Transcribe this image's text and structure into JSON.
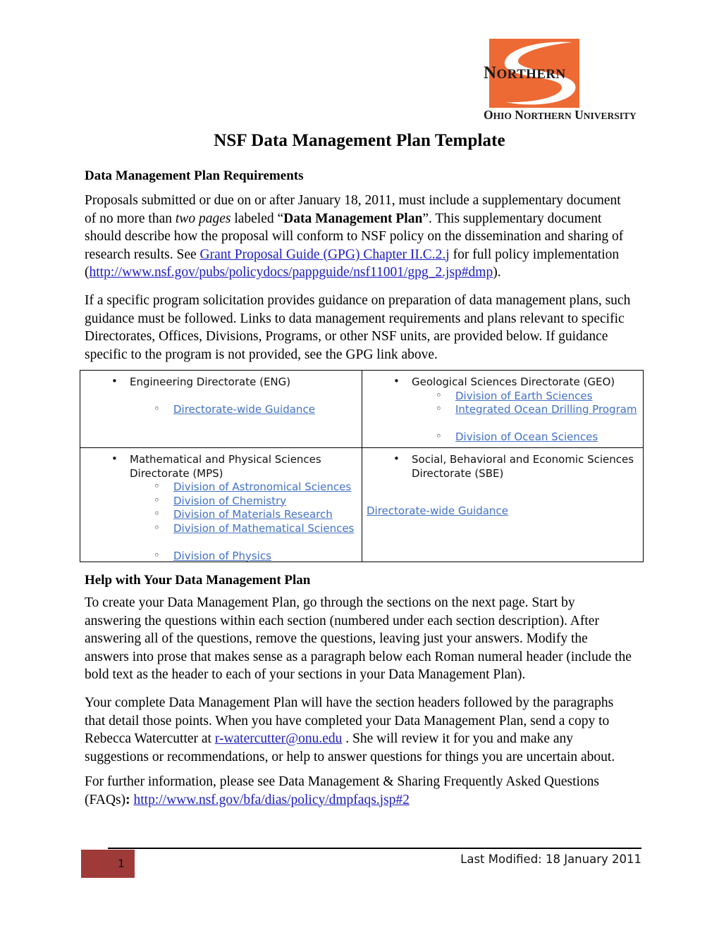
{
  "logo": {
    "word_main": "NORTHERN",
    "word_sub": "OHIO NORTHERN UNIVERSITY",
    "brand_color": "#ED6A35"
  },
  "document": {
    "title": "NSF Data Management Plan Template"
  },
  "sections": {
    "requirements_heading": "Data Management Plan Requirements",
    "para1": {
      "t1": "Proposals submitted or due on or after January 18, 2011, must include a supplementary document of no more than ",
      "italic1": "two pages",
      "t2": " labeled “",
      "bold1": "Data Management Plan",
      "t3": "”. This supplementary document should describe how the proposal will conform to NSF policy on the dissemination and sharing of research results. See ",
      "link1": "Grant Proposal Guide (GPG) Chapter II.C.2.j",
      "t4": " for full policy implementation (",
      "link2": "http://www.nsf.gov/pubs/policydocs/pappguide/nsf11001/gpg_2.jsp#dmp",
      "t5": ")."
    },
    "para2": "If a specific program solicitation provides guidance on preparation of data management plans, such guidance must be followed.  Links to data management requirements and plans relevant to specific Directorates, Offices, Divisions, Programs, or other NSF units, are provided below. If guidance specific to the program is not provided, see the GPG link above.",
    "help_heading": "Help with Your Data Management Plan",
    "para3": "To create your Data Management Plan, go through the sections on the next page. Start by answering the questions within each section (numbered under each section description). After answering all of the questions, remove the questions, leaving just your answers. Modify the answers into prose that makes sense as a paragraph below each Roman numeral header (include the bold text as the header to each of your sections in your Data Management Plan).",
    "para4": {
      "t1": "Your complete Data Management Plan will have the section headers followed by the paragraphs that detail those points. When you have completed your Data Management Plan, send a copy to Rebecca Watercutter at ",
      "email": "r-watercutter@onu.edu",
      "t2": " . She will review it for you and make any suggestions or recommendations, or help to answer questions for things you are uncertain about."
    },
    "para5": {
      "t1": "For further information, please see Data Management & Sharing Frequently Asked Questions (FAQs)",
      "colon": ": ",
      "link": "http://www.nsf.gov/bfa/dias/policy/dmpfaqs.jsp#2"
    }
  },
  "directorate_table": {
    "link_color": "#4271C6",
    "cells": {
      "eng": {
        "heading": "Engineering Directorate (ENG)",
        "links": [
          "Directorate-wide Guidance"
        ]
      },
      "geo": {
        "heading": "Geological Sciences Directorate (GEO)",
        "links": [
          "Division of Earth Sciences",
          "Integrated Ocean Drilling Program",
          "Division of Ocean Sciences"
        ]
      },
      "mps": {
        "heading_line1": "Mathematical and Physical Sciences",
        "heading_line2": "Directorate (MPS)",
        "links": [
          "Division of Astronomical Sciences ",
          "Division of Chemistry",
          "Division of Materials Research",
          "Division of Mathematical Sciences",
          "Division of Physics "
        ]
      },
      "sbe": {
        "heading_line1": "Social, Behavioral and Economic Sciences",
        "heading_line2": "Directorate (SBE)",
        "links": [
          "Directorate-wide Guidance"
        ]
      }
    }
  },
  "footer": {
    "page_number": "1",
    "last_modified": "Last Modified:  18 January 2011",
    "badge_color": "#9E3B38"
  }
}
